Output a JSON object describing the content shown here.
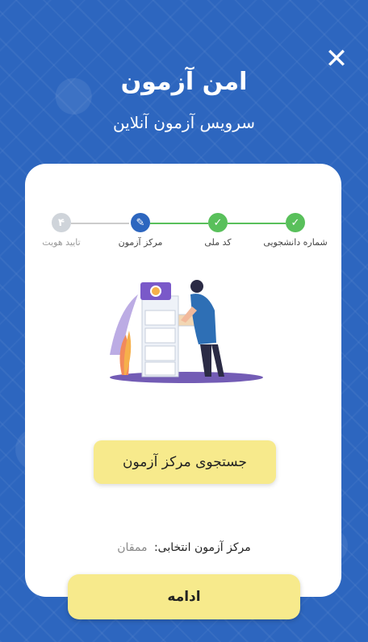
{
  "header": {
    "title": "امن آزمون",
    "subtitle": "سرویس آزمون آنلاین",
    "close_icon": "close-icon"
  },
  "stepper": {
    "steps": [
      {
        "label": "شماره دانشجویی",
        "status": "done",
        "glyph": "✓"
      },
      {
        "label": "کد ملی",
        "status": "done",
        "glyph": "✓"
      },
      {
        "label": "مرکز آزمون",
        "status": "active",
        "glyph": "✎"
      },
      {
        "label": "تایید هویت",
        "status": "pending",
        "glyph": "۴"
      }
    ]
  },
  "main": {
    "search_button": "جستجوی مرکز آزمون",
    "selected_label": "مرکز آزمون انتخابی:",
    "selected_value": "ممقان",
    "continue_button": "ادامه"
  },
  "colors": {
    "background": "#2d66bf",
    "done": "#59c05b",
    "active": "#2d66bf",
    "pending": "#cfd4da",
    "button": "#f7ea8c"
  }
}
